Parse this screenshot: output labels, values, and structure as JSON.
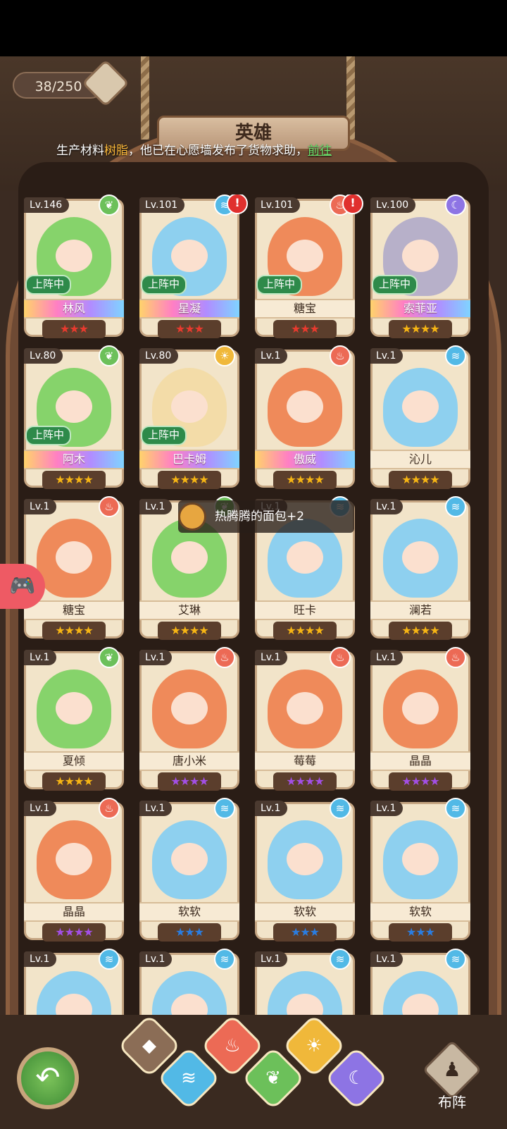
{
  "header": {
    "hero_count": "38/250",
    "title": "英雄",
    "notice": {
      "prefix": "生产材料",
      "highlight": "树脂",
      "middle": "，他已在心愿墙发布了货物求助，",
      "link": "前往"
    }
  },
  "toast": {
    "text": "热腾腾的面包+2"
  },
  "heroes": [
    {
      "level": "Lv.146",
      "name": "林风",
      "element": "leaf",
      "status": "上阵中",
      "stars": 3,
      "star_color": "red",
      "rainbow": true,
      "alert": false
    },
    {
      "level": "Lv.101",
      "name": "星凝",
      "element": "water",
      "status": "上阵中",
      "stars": 3,
      "star_color": "red",
      "rainbow": true,
      "alert": true
    },
    {
      "level": "Lv.101",
      "name": "糖宝",
      "element": "fire",
      "status": "上阵中",
      "stars": 3,
      "star_color": "red",
      "rainbow": false,
      "alert": true
    },
    {
      "level": "Lv.100",
      "name": "索菲亚",
      "element": "moon",
      "status": "上阵中",
      "stars": 4,
      "star_color": "gold",
      "rainbow": true,
      "alert": false
    },
    {
      "level": "Lv.80",
      "name": "阿木",
      "element": "leaf",
      "status": "上阵中",
      "stars": 4,
      "star_color": "gold",
      "rainbow": true,
      "alert": false
    },
    {
      "level": "Lv.80",
      "name": "巴卡姆",
      "element": "sun",
      "status": "上阵中",
      "stars": 4,
      "star_color": "gold",
      "rainbow": true,
      "alert": false
    },
    {
      "level": "Lv.1",
      "name": "傲威",
      "element": "fire",
      "status": "",
      "stars": 4,
      "star_color": "gold",
      "rainbow": true,
      "alert": false
    },
    {
      "level": "Lv.1",
      "name": "沁儿",
      "element": "water",
      "status": "",
      "stars": 4,
      "star_color": "gold",
      "rainbow": false,
      "alert": false
    },
    {
      "level": "Lv.1",
      "name": "糖宝",
      "element": "fire",
      "status": "",
      "stars": 4,
      "star_color": "gold",
      "rainbow": false,
      "alert": false
    },
    {
      "level": "Lv.1",
      "name": "艾琳",
      "element": "leaf",
      "status": "",
      "stars": 4,
      "star_color": "gold",
      "rainbow": false,
      "alert": false
    },
    {
      "level": "Lv.1",
      "name": "旺卡",
      "element": "water",
      "status": "",
      "stars": 4,
      "star_color": "gold",
      "rainbow": false,
      "alert": false
    },
    {
      "level": "Lv.1",
      "name": "澜若",
      "element": "water",
      "status": "",
      "stars": 4,
      "star_color": "gold",
      "rainbow": false,
      "alert": false
    },
    {
      "level": "Lv.1",
      "name": "夏倾",
      "element": "leaf",
      "status": "",
      "stars": 4,
      "star_color": "gold",
      "rainbow": false,
      "alert": false
    },
    {
      "level": "Lv.1",
      "name": "唐小米",
      "element": "fire",
      "status": "",
      "stars": 4,
      "star_color": "purple",
      "rainbow": false,
      "alert": false
    },
    {
      "level": "Lv.1",
      "name": "莓莓",
      "element": "fire",
      "status": "",
      "stars": 4,
      "star_color": "purple",
      "rainbow": false,
      "alert": false
    },
    {
      "level": "Lv.1",
      "name": "晶晶",
      "element": "fire",
      "status": "",
      "stars": 4,
      "star_color": "purple",
      "rainbow": false,
      "alert": false
    },
    {
      "level": "Lv.1",
      "name": "晶晶",
      "element": "fire",
      "status": "",
      "stars": 4,
      "star_color": "purple",
      "rainbow": false,
      "alert": false
    },
    {
      "level": "Lv.1",
      "name": "软软",
      "element": "water",
      "status": "",
      "stars": 3,
      "star_color": "blue",
      "rainbow": false,
      "alert": false
    },
    {
      "level": "Lv.1",
      "name": "软软",
      "element": "water",
      "status": "",
      "stars": 3,
      "star_color": "blue",
      "rainbow": false,
      "alert": false
    },
    {
      "level": "Lv.1",
      "name": "软软",
      "element": "water",
      "status": "",
      "stars": 3,
      "star_color": "blue",
      "rainbow": false,
      "alert": false
    },
    {
      "level": "Lv.1",
      "name": "",
      "element": "water",
      "status": "",
      "stars": 0,
      "star_color": "blue",
      "rainbow": false,
      "alert": false
    },
    {
      "level": "Lv.1",
      "name": "",
      "element": "water",
      "status": "",
      "stars": 0,
      "star_color": "blue",
      "rainbow": false,
      "alert": false
    },
    {
      "level": "Lv.1",
      "name": "",
      "element": "water",
      "status": "",
      "stars": 0,
      "star_color": "blue",
      "rainbow": false,
      "alert": false
    },
    {
      "level": "Lv.1",
      "name": "",
      "element": "water",
      "status": "",
      "stars": 0,
      "star_color": "blue",
      "rainbow": false,
      "alert": false
    }
  ],
  "filters": [
    {
      "id": "all",
      "icon": "grid-icon",
      "color": "#8b6d56"
    },
    {
      "id": "water",
      "icon": "water-icon",
      "color": "#52b9e6"
    },
    {
      "id": "fire",
      "icon": "fire-icon",
      "color": "#ec6a55"
    },
    {
      "id": "leaf",
      "icon": "leaf-icon",
      "color": "#6cc05a"
    },
    {
      "id": "sun",
      "icon": "sun-icon",
      "color": "#f0b83a"
    },
    {
      "id": "moon",
      "icon": "moon-icon",
      "color": "#8d74e4"
    }
  ],
  "footer": {
    "formation_label": "布阵"
  },
  "colors": {
    "leaf": "#6cc05a",
    "water": "#52b9e6",
    "fire": "#ec6a55",
    "sun": "#f0b83a",
    "moon": "#8d74e4"
  }
}
